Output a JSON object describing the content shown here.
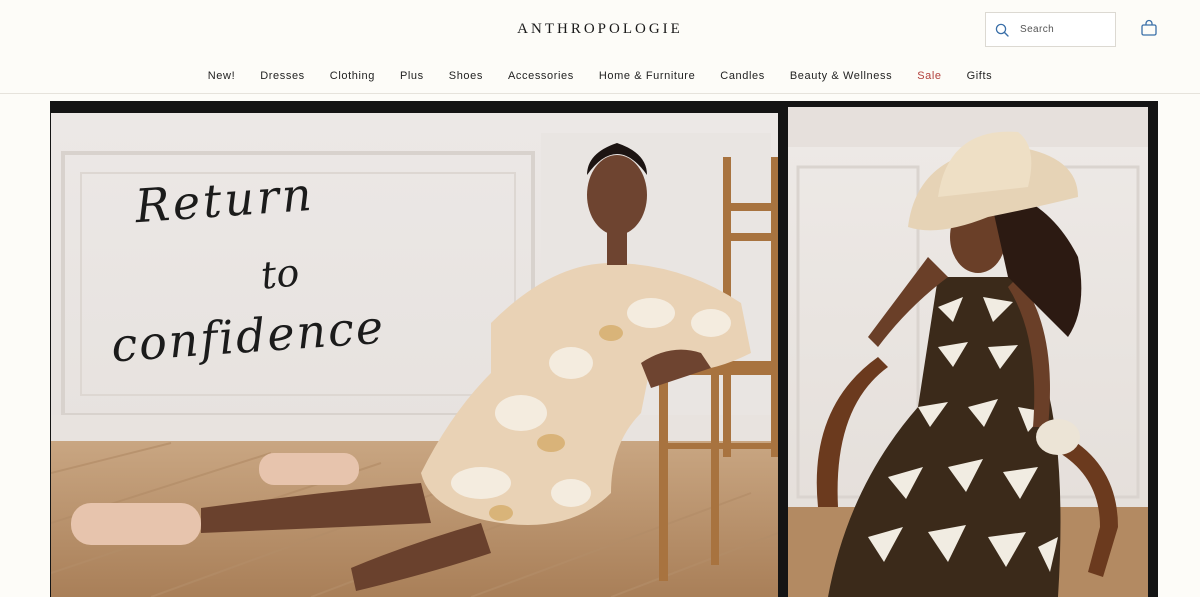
{
  "header": {
    "logo": "ANTHROPOLOGIE",
    "search": {
      "placeholder": "Search",
      "value": ""
    },
    "icons": {
      "search": "search-icon",
      "bag": "shopping-bag-icon"
    }
  },
  "nav": {
    "items": [
      {
        "label": "New!"
      },
      {
        "label": "Dresses"
      },
      {
        "label": "Clothing"
      },
      {
        "label": "Plus"
      },
      {
        "label": "Shoes"
      },
      {
        "label": "Accessories"
      },
      {
        "label": "Home & Furniture"
      },
      {
        "label": "Candles"
      },
      {
        "label": "Beauty & Wellness"
      },
      {
        "label": "Sale"
      },
      {
        "label": "Gifts"
      }
    ]
  },
  "hero": {
    "headline": {
      "line1": "Return",
      "line2": "to",
      "line3": "confidence"
    }
  },
  "colors": {
    "background": "#fdfcf8",
    "sale": "#b2403c",
    "text": "#222222"
  }
}
